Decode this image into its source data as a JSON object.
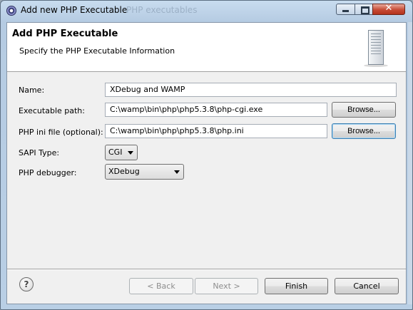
{
  "window": {
    "title": "Add new PHP Executable",
    "ghost_title": "PHP executables"
  },
  "banner": {
    "title": "Add PHP Executable",
    "description": "Specify the PHP Executable Information"
  },
  "form": {
    "name_label": "Name:",
    "name_value": "XDebug and WAMP",
    "exec_label": "Executable path:",
    "exec_value": "C:\\wamp\\bin\\php\\php5.3.8\\php-cgi.exe",
    "ini_label": "PHP ini file (optional):",
    "ini_value": "C:\\wamp\\bin\\php\\php5.3.8\\php.ini",
    "browse_label": "Browse...",
    "sapi_label": "SAPI Type:",
    "sapi_value": "CGI",
    "debugger_label": "PHP debugger:",
    "debugger_value": "XDebug"
  },
  "buttons": {
    "help": "?",
    "back": "< Back",
    "next": "Next >",
    "finish": "Finish",
    "cancel": "Cancel"
  },
  "icons": {
    "app": "eclipse-icon",
    "banner": "server-icon",
    "help": "help-icon"
  }
}
